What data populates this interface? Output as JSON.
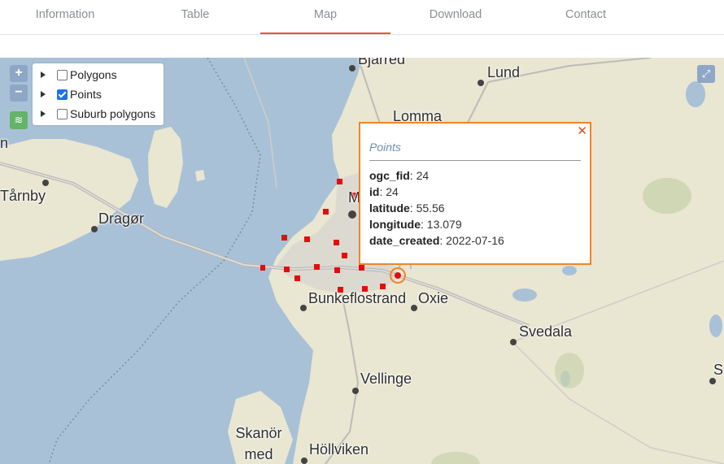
{
  "tabs": [
    {
      "label": "Information"
    },
    {
      "label": "Table"
    },
    {
      "label": "Map",
      "active": true
    },
    {
      "label": "Download"
    },
    {
      "label": "Contact"
    }
  ],
  "map": {
    "zoom_in_label": "+",
    "zoom_out_label": "−",
    "layers": [
      {
        "label": "Polygons",
        "checked": false
      },
      {
        "label": "Points",
        "checked": true
      },
      {
        "label": "Suburb polygons",
        "checked": false
      }
    ],
    "place_labels": [
      "Bjärred",
      "Lund",
      "Lomma",
      "Tårnby",
      "Dragør",
      "Bunkeflostrand",
      "Oxie",
      "Svedala",
      "Vellinge",
      "Skanör med",
      "Höllviken",
      "M",
      "S",
      "n"
    ],
    "colors": {
      "water": "#a9c1d6",
      "land": "#e9e6d2",
      "point": "#e30d0d",
      "popup_border": "#f0852a",
      "active_tab": "#e8542b"
    }
  },
  "popup": {
    "title": "Points",
    "close_label": "✕",
    "fields": [
      {
        "key": "ogc_fid",
        "value": "24"
      },
      {
        "key": "id",
        "value": "24"
      },
      {
        "key": "latitude",
        "value": "55.56"
      },
      {
        "key": "longitude",
        "value": "13.079"
      },
      {
        "key": "date_created",
        "value": "2022-07-16"
      }
    ]
  }
}
